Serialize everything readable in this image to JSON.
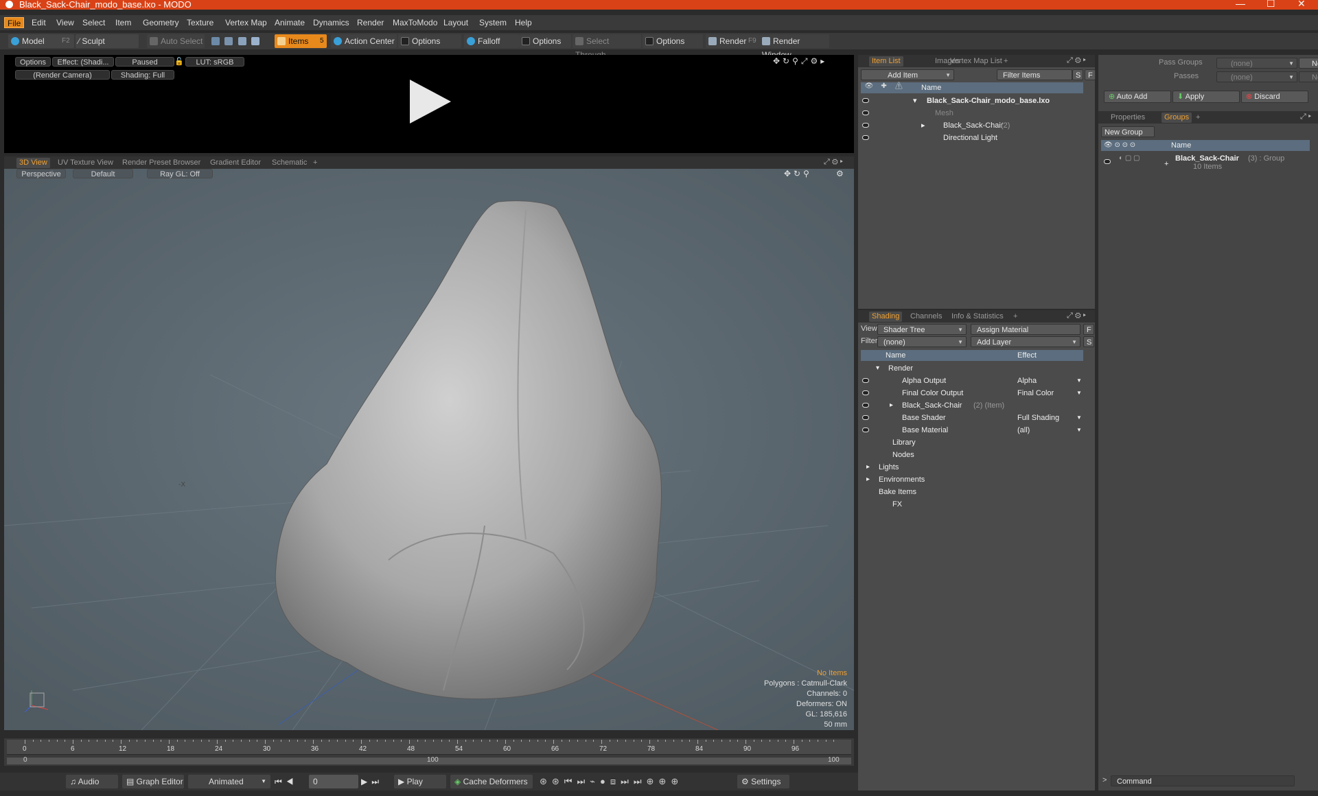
{
  "window": {
    "title": "Black_Sack-Chair_modo_base.lxo - MODO",
    "minimize": "—",
    "maximize": "☐",
    "close": "✕"
  },
  "menu": [
    "File",
    "Edit",
    "View",
    "Select",
    "Item",
    "Geometry",
    "Texture",
    "Vertex Map",
    "Animate",
    "Dynamics",
    "Render",
    "MaxToModo",
    "Layout",
    "System",
    "Help"
  ],
  "toolbar": {
    "model": "Model",
    "model_key": "F2",
    "sculpt": "Sculpt",
    "auto_select": "Auto Select",
    "items": "Items",
    "items_key": "5",
    "action_center": "Action Center",
    "options1": "Options",
    "falloff": "Falloff",
    "options2": "Options",
    "select_through": "Select Through",
    "options3": "Options",
    "render": "Render",
    "render_key": "F9",
    "render_window": "Render Window"
  },
  "preview": {
    "options": "Options",
    "effect": "Effect: (Shadi...",
    "paused": "Paused",
    "lut": "LUT: sRGB",
    "camera": "(Render Camera)",
    "shading": "Shading: Full"
  },
  "view_tabs": [
    "3D View",
    "UV Texture View",
    "Render Preset Browser",
    "Gradient Editor",
    "Schematic",
    "+"
  ],
  "viewport": {
    "perspective": "Perspective",
    "default": "Default",
    "raygl": "Ray GL: Off",
    "axis_x": "-X",
    "info": {
      "selection": "No Items",
      "polygons": "Polygons : Catmull-Clark",
      "channels": "Channels: 0",
      "deformers": "Deformers: ON",
      "gl": "GL: 185,616",
      "lens": "50 mm"
    }
  },
  "timeline": {
    "ticks": [
      "0",
      "6",
      "12",
      "18",
      "24",
      "30",
      "36",
      "42",
      "48",
      "54",
      "60",
      "66",
      "72",
      "78",
      "84",
      "90",
      "96"
    ],
    "range_start": "0",
    "range_mid": "100",
    "range_end": "100"
  },
  "bottombar": {
    "audio": "Audio",
    "graph_editor": "Graph Editor",
    "animated": "Animated",
    "frame": "0",
    "play": "Play",
    "cache_deformers": "Cache Deformers",
    "settings": "Settings"
  },
  "item_list": {
    "tabs": [
      "Item List",
      "Images",
      "Vertex Map List",
      "+"
    ],
    "add_item": "Add Item",
    "filter_items": "Filter Items",
    "s_btn": "S",
    "f_btn": "F",
    "col_name": "Name",
    "rows": [
      {
        "label": "Black_Sack-Chair_modo_base.lxo",
        "count": ""
      },
      {
        "label": "Mesh",
        "count": ""
      },
      {
        "label": "Black_Sack-Chair",
        "count": "(2)"
      },
      {
        "label": "Directional Light",
        "count": ""
      }
    ]
  },
  "shading": {
    "tabs": [
      "Shading",
      "Channels",
      "Info & Statistics",
      "+"
    ],
    "view_label": "View",
    "view_value": "Shader Tree",
    "assign_material": "Assign Material",
    "f_btn": "F",
    "filter_label": "Filter",
    "filter_value": "(none)",
    "add_layer": "Add Layer",
    "s_btn": "S",
    "col_name": "Name",
    "col_effect": "Effect",
    "rows": [
      {
        "label": "Render",
        "suffix": "",
        "effect": ""
      },
      {
        "label": "Alpha Output",
        "suffix": "",
        "effect": "Alpha"
      },
      {
        "label": "Final Color Output",
        "suffix": "",
        "effect": "Final Color"
      },
      {
        "label": "Black_Sack-Chair",
        "suffix": "(2) (Item)",
        "effect": ""
      },
      {
        "label": "Base Shader",
        "suffix": "",
        "effect": "Full Shading"
      },
      {
        "label": "Base Material",
        "suffix": "",
        "effect": "(all)"
      },
      {
        "label": "Library",
        "suffix": "",
        "effect": ""
      },
      {
        "label": "Nodes",
        "suffix": "",
        "effect": ""
      },
      {
        "label": "Lights",
        "suffix": "",
        "effect": ""
      },
      {
        "label": "Environments",
        "suffix": "",
        "effect": ""
      },
      {
        "label": "Bake Items",
        "suffix": "",
        "effect": ""
      },
      {
        "label": "FX",
        "suffix": "",
        "effect": ""
      }
    ]
  },
  "groups_panel": {
    "pass_groups_label": "Pass Groups",
    "pass_groups_value": "(none)",
    "new1": "New",
    "passes_label": "Passes",
    "passes_value": "(none)",
    "new2": "New",
    "auto_add": "Auto Add",
    "apply": "Apply",
    "discard": "Discard",
    "tabs": [
      "Properties",
      "Groups",
      "+"
    ],
    "new_group": "New Group",
    "col_name": "Name",
    "group_name": "Black_Sack-Chair",
    "group_suffix": "(3) : Group",
    "group_items": "10 Items"
  },
  "command": {
    "placeholder": "Command",
    "prompt": ">"
  }
}
